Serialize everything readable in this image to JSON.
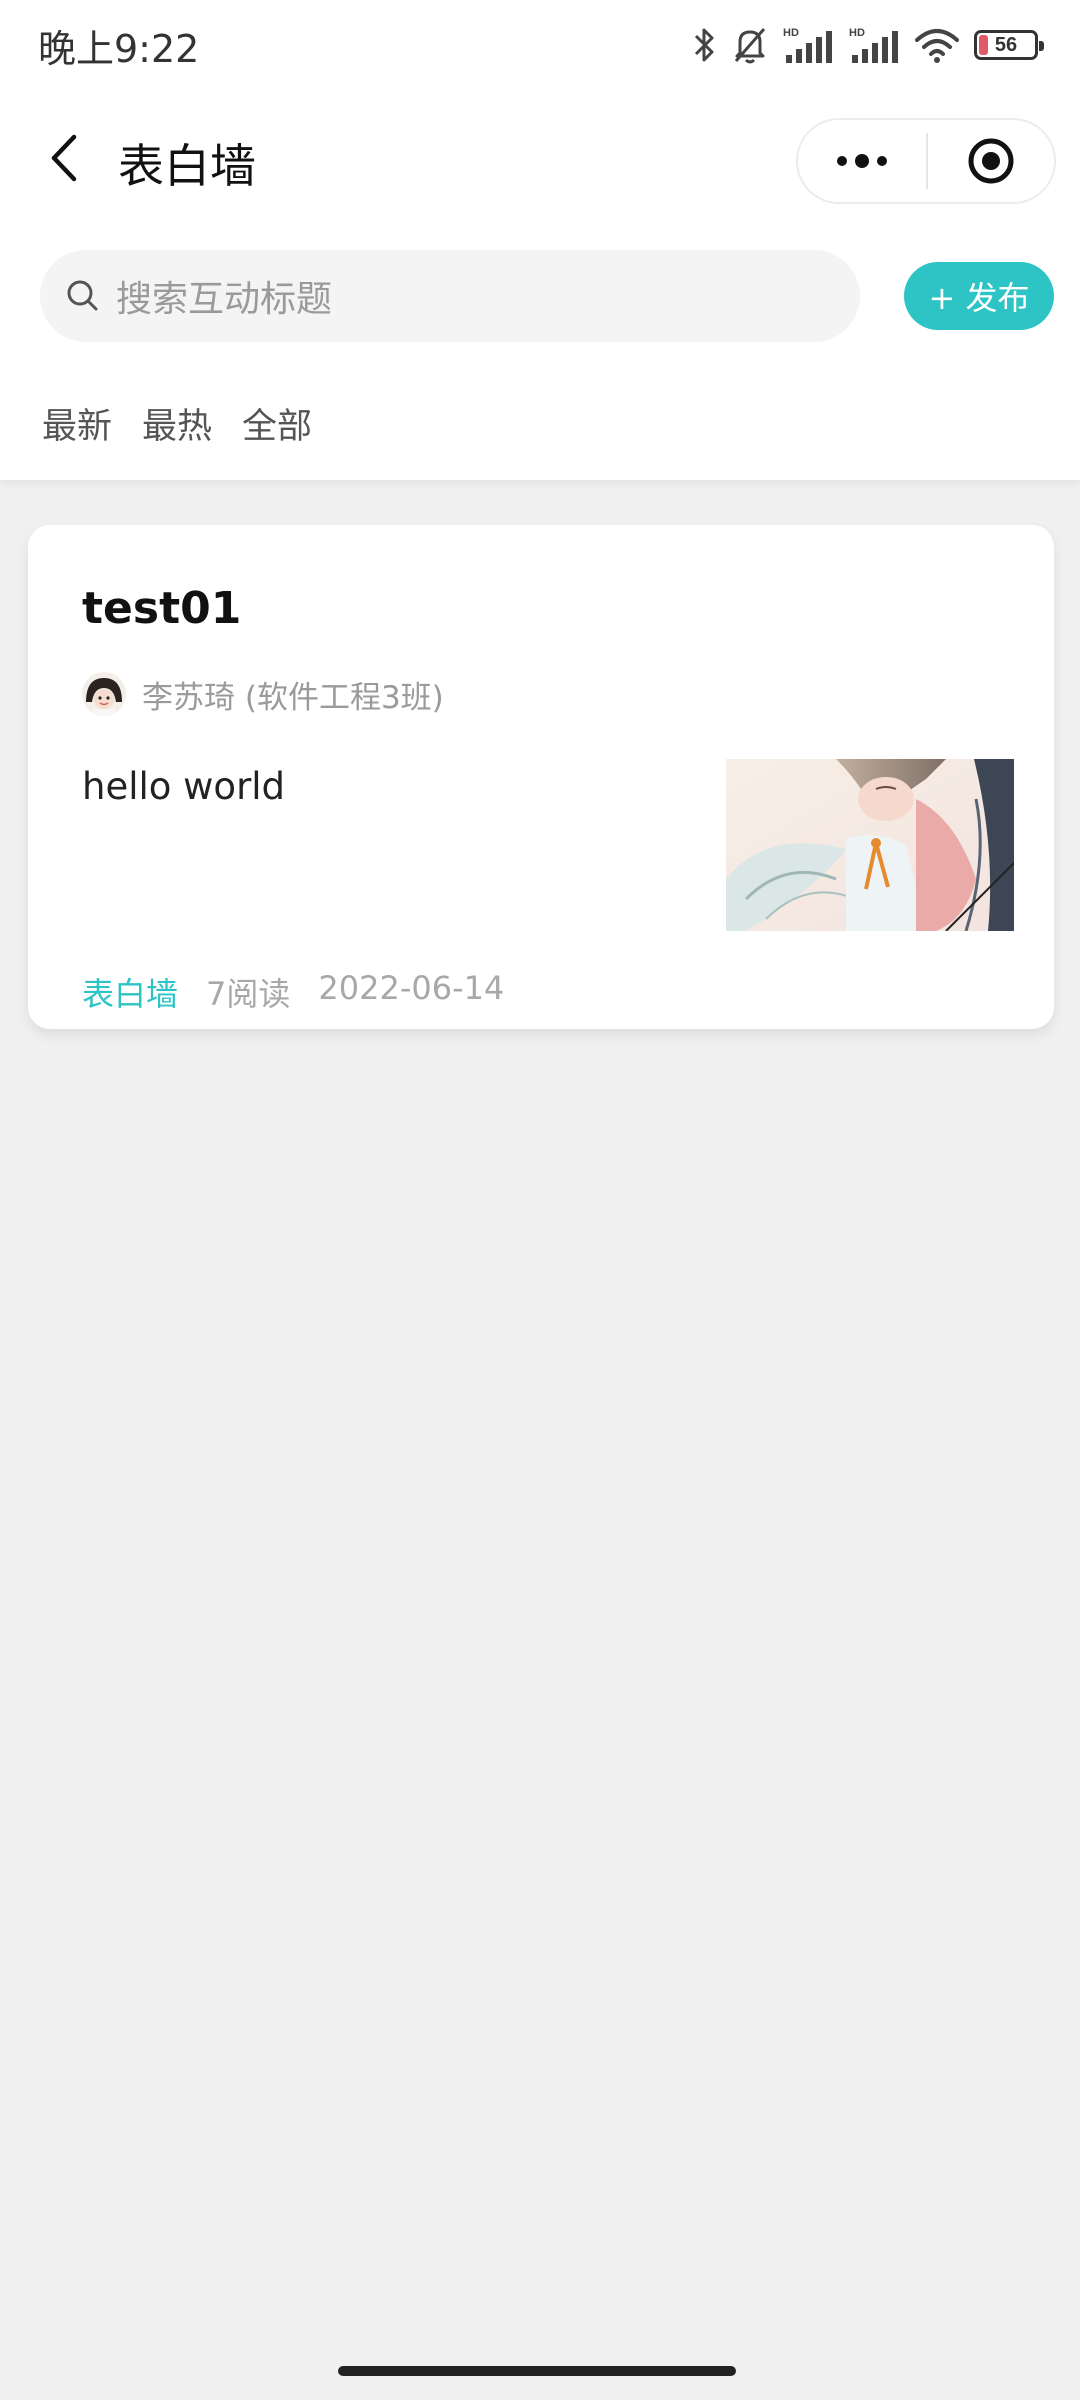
{
  "status_bar": {
    "time": "晚上9:22",
    "battery_level": "56",
    "battery_fraction": 0.56,
    "icons": [
      "bluetooth-icon",
      "mute-bell-icon",
      "hd-signal-icon",
      "hd-signal-icon",
      "wifi-icon",
      "battery-icon"
    ]
  },
  "nav": {
    "title": "表白墙"
  },
  "search": {
    "placeholder": "搜索互动标题",
    "publish_label": "+ 发布"
  },
  "tabs": [
    {
      "label": "最新"
    },
    {
      "label": "最热"
    },
    {
      "label": "全部"
    }
  ],
  "posts": [
    {
      "title": "test01",
      "author": "李苏琦 (软件工程3班)",
      "content": "hello world",
      "category": "表白墙",
      "reads": "7阅读",
      "date": "2022-06-14"
    }
  ],
  "colors": {
    "accent": "#2ec3c4",
    "background": "#f0f0f0"
  }
}
